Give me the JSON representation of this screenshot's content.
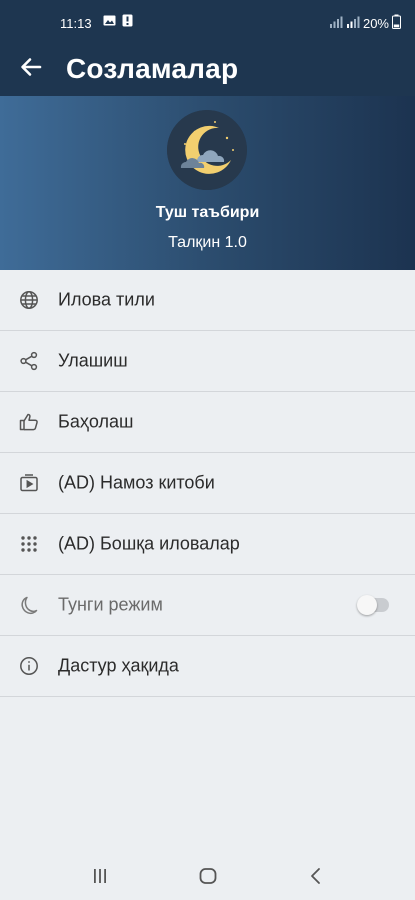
{
  "status_bar": {
    "time": "11:13",
    "battery": "20%"
  },
  "app_bar": {
    "title": "Созламалар",
    "back_icon": "arrow-left-icon"
  },
  "profile": {
    "app_name": "Туш таъбири",
    "version": "Талқин 1.0",
    "logo_icon": "moon-cloud-icon"
  },
  "menu": {
    "items": [
      {
        "label": "Илова тили",
        "icon": "globe-icon"
      },
      {
        "label": "Улашиш",
        "icon": "share-icon"
      },
      {
        "label": "Баҳолаш",
        "icon": "thumbs-up-icon"
      },
      {
        "label": "(AD) Намоз китоби",
        "icon": "play-box-icon"
      },
      {
        "label": "(AD) Бошқа иловалар",
        "icon": "apps-grid-icon"
      },
      {
        "label": "Тунги режим",
        "icon": "moon-icon",
        "toggle": false
      },
      {
        "label": "Дастур ҳақида",
        "icon": "info-icon"
      }
    ]
  },
  "colors": {
    "header_dark": "#1e3650",
    "header_gradient_start": "#3f6c98",
    "background": "#eceff2"
  },
  "nav_bar": {
    "icons": [
      "recents-icon",
      "home-icon",
      "back-icon"
    ]
  }
}
